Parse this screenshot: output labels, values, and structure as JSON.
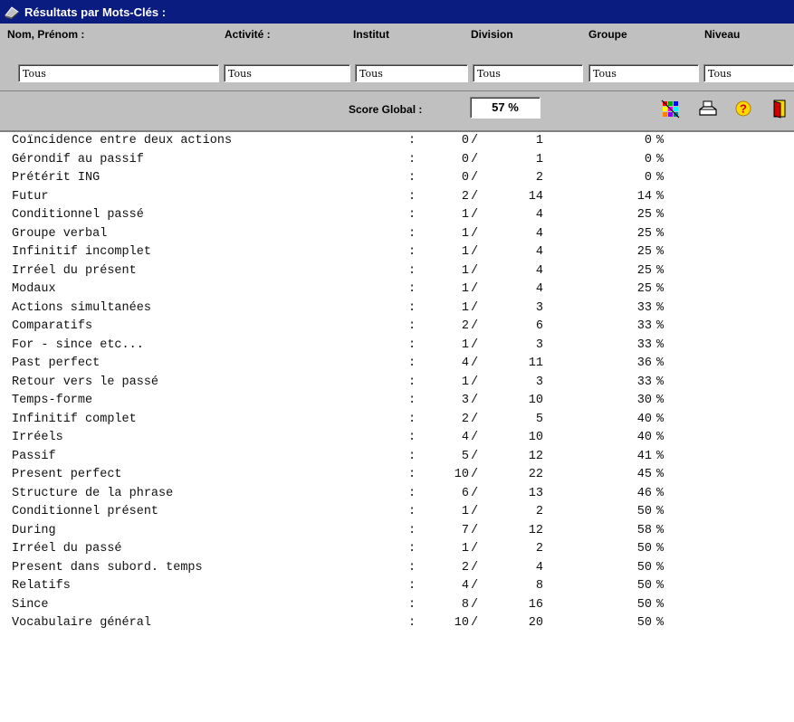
{
  "window": {
    "title": "Résultats par Mots-Clés :",
    "title_icon": "app-icon"
  },
  "filters": [
    {
      "label": "Nom, Prénom :",
      "value": "Tous"
    },
    {
      "label": "Activité :",
      "value": "Tous"
    },
    {
      "label": "Institut",
      "value": "Tous"
    },
    {
      "label": "Division",
      "value": "Tous"
    },
    {
      "label": "Groupe",
      "value": "Tous"
    },
    {
      "label": "Niveau",
      "value": "Tous"
    }
  ],
  "score": {
    "label": "Score Global :",
    "value": "57 %"
  },
  "toolbar": [
    "palette-icon",
    "print-icon",
    "help-icon",
    "exit-door-icon"
  ],
  "results": [
    {
      "label": "Coïncidence entre deux actions",
      "sep": ":",
      "correct": "0",
      "slash": "/",
      "total": "1",
      "pct": "0",
      "pct_sign": "%"
    },
    {
      "label": "Gérondif au passif",
      "sep": ":",
      "correct": "0",
      "slash": "/",
      "total": "1",
      "pct": "0",
      "pct_sign": "%"
    },
    {
      "label": "Prétérit ING",
      "sep": ":",
      "correct": "0",
      "slash": "/",
      "total": "2",
      "pct": "0",
      "pct_sign": "%"
    },
    {
      "label": "Futur",
      "sep": ":",
      "correct": "2",
      "slash": "/",
      "total": "14",
      "pct": "14",
      "pct_sign": "%"
    },
    {
      "label": "Conditionnel passé",
      "sep": ":",
      "correct": "1",
      "slash": "/",
      "total": "4",
      "pct": "25",
      "pct_sign": "%"
    },
    {
      "label": "Groupe verbal",
      "sep": ":",
      "correct": "1",
      "slash": "/",
      "total": "4",
      "pct": "25",
      "pct_sign": "%"
    },
    {
      "label": "Infinitif incomplet",
      "sep": ":",
      "correct": "1",
      "slash": "/",
      "total": "4",
      "pct": "25",
      "pct_sign": "%"
    },
    {
      "label": "Irréel du présent",
      "sep": ":",
      "correct": "1",
      "slash": "/",
      "total": "4",
      "pct": "25",
      "pct_sign": "%"
    },
    {
      "label": "Modaux",
      "sep": ":",
      "correct": "1",
      "slash": "/",
      "total": "4",
      "pct": "25",
      "pct_sign": "%"
    },
    {
      "label": "Actions simultanées",
      "sep": ":",
      "correct": "1",
      "slash": "/",
      "total": "3",
      "pct": "33",
      "pct_sign": "%"
    },
    {
      "label": "Comparatifs",
      "sep": ":",
      "correct": "2",
      "slash": "/",
      "total": "6",
      "pct": "33",
      "pct_sign": "%"
    },
    {
      "label": "For - since etc...",
      "sep": ":",
      "correct": "1",
      "slash": "/",
      "total": "3",
      "pct": "33",
      "pct_sign": "%"
    },
    {
      "label": "Past perfect",
      "sep": ":",
      "correct": "4",
      "slash": "/",
      "total": "11",
      "pct": "36",
      "pct_sign": "%"
    },
    {
      "label": "Retour vers le passé",
      "sep": ":",
      "correct": "1",
      "slash": "/",
      "total": "3",
      "pct": "33",
      "pct_sign": "%"
    },
    {
      "label": "Temps-forme",
      "sep": ":",
      "correct": "3",
      "slash": "/",
      "total": "10",
      "pct": "30",
      "pct_sign": "%"
    },
    {
      "label": "Infinitif complet",
      "sep": ":",
      "correct": "2",
      "slash": "/",
      "total": "5",
      "pct": "40",
      "pct_sign": "%"
    },
    {
      "label": "Irréels",
      "sep": ":",
      "correct": "4",
      "slash": "/",
      "total": "10",
      "pct": "40",
      "pct_sign": "%"
    },
    {
      "label": "Passif",
      "sep": ":",
      "correct": "5",
      "slash": "/",
      "total": "12",
      "pct": "41",
      "pct_sign": "%"
    },
    {
      "label": "Present perfect",
      "sep": ":",
      "correct": "10",
      "slash": "/",
      "total": "22",
      "pct": "45",
      "pct_sign": "%"
    },
    {
      "label": "Structure de la phrase",
      "sep": ":",
      "correct": "6",
      "slash": "/",
      "total": "13",
      "pct": "46",
      "pct_sign": "%"
    },
    {
      "label": "Conditionnel présent",
      "sep": ":",
      "correct": "1",
      "slash": "/",
      "total": "2",
      "pct": "50",
      "pct_sign": "%"
    },
    {
      "label": "During",
      "sep": ":",
      "correct": "7",
      "slash": "/",
      "total": "12",
      "pct": "58",
      "pct_sign": "%"
    },
    {
      "label": "Irréel du passé",
      "sep": ":",
      "correct": "1",
      "slash": "/",
      "total": "2",
      "pct": "50",
      "pct_sign": "%"
    },
    {
      "label": "Present dans subord. temps",
      "sep": ":",
      "correct": "2",
      "slash": "/",
      "total": "4",
      "pct": "50",
      "pct_sign": "%"
    },
    {
      "label": "Relatifs",
      "sep": ":",
      "correct": "4",
      "slash": "/",
      "total": "8",
      "pct": "50",
      "pct_sign": "%"
    },
    {
      "label": "Since",
      "sep": ":",
      "correct": "8",
      "slash": "/",
      "total": "16",
      "pct": "50",
      "pct_sign": "%"
    },
    {
      "label": "Vocabulaire général",
      "sep": ":",
      "correct": "10",
      "slash": "/",
      "total": "20",
      "pct": "50",
      "pct_sign": "%"
    }
  ]
}
